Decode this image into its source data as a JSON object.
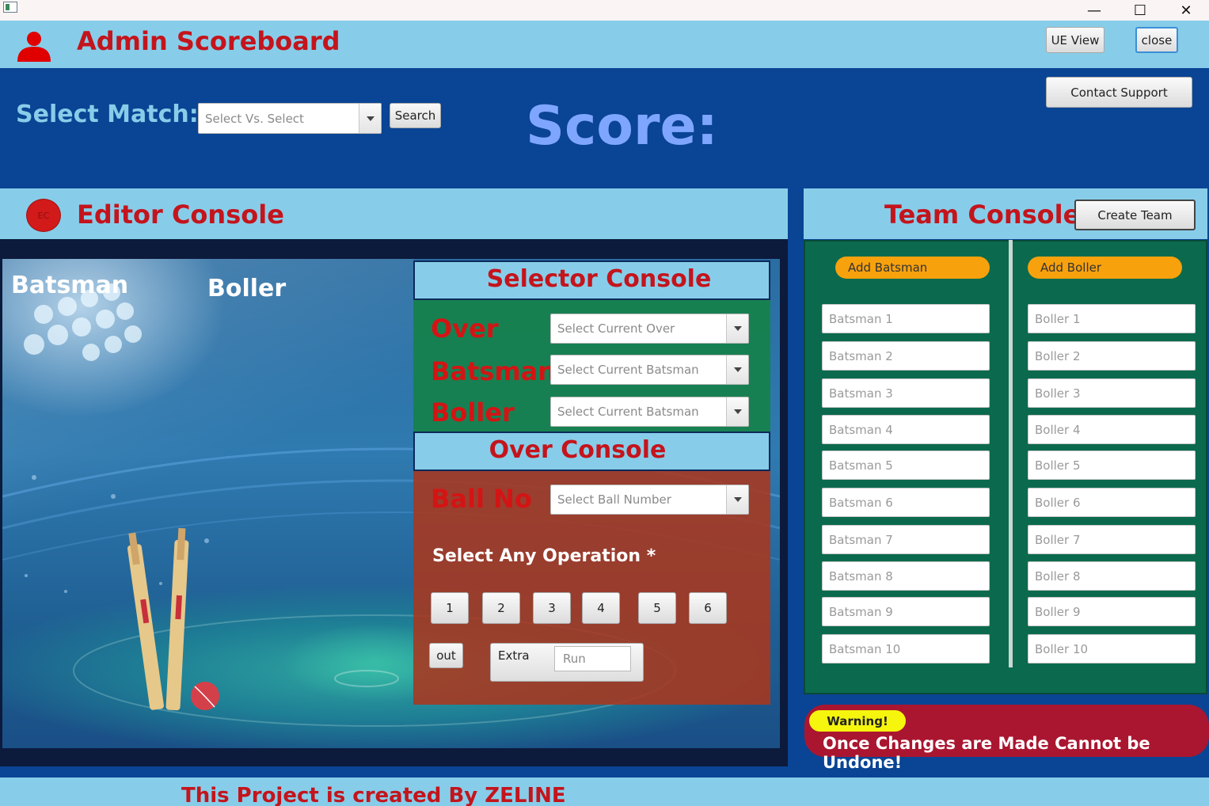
{
  "window": {
    "minimize": "—",
    "maximize": "☐",
    "close": "✕"
  },
  "header": {
    "title": "Admin Scoreboard",
    "ue_view_label": "UE View",
    "close_label": "close"
  },
  "top": {
    "match_label": "Select Match:",
    "match_placeholder": "Select Vs. Select",
    "search_label": "Search",
    "score_label": "Score:",
    "contact_label": "Contact Support"
  },
  "editor": {
    "badge": "EC",
    "title": "Editor Console",
    "batsman_label": "Batsman",
    "boller_label": "Boller"
  },
  "selector": {
    "title": "Selector Console",
    "over_label": "Over",
    "over_placeholder": "Select Current Over",
    "batsman_label": "Batsman",
    "batsman_placeholder": "Select Current Batsman",
    "boller_label": "Boller",
    "boller_placeholder": "Select Current Batsman"
  },
  "over_console": {
    "title": "Over Console",
    "ball_label": "Ball No",
    "ball_placeholder": "Select Ball Number",
    "operation_label": "Select Any Operation *",
    "run_buttons": [
      "1",
      "2",
      "3",
      "4",
      "5",
      "6"
    ],
    "out_label": "out",
    "extra_label": "Extra",
    "run_placeholder": "Run"
  },
  "team": {
    "title": "Team Console",
    "create_label": "Create Team",
    "add_batsman_label": "Add Batsman",
    "add_boller_label": "Add Boller",
    "batsmen": [
      "Batsman 1",
      "Batsman 2",
      "Batsman 3",
      "Batsman 4",
      "Batsman 5",
      "Batsman 6",
      "Batsman 7",
      "Batsman 8",
      "Batsman 9",
      "Batsman 10"
    ],
    "bollers": [
      "Boller 1",
      "Boller 2",
      "Boller 3",
      "Boller 4",
      "Boller 5",
      "Boller 6",
      "Boller 7",
      "Boller 8",
      "Boller 9",
      "Boller 10"
    ]
  },
  "warning": {
    "badge": "Warning!",
    "message": "Once Changes are Made Cannot be Undone!"
  },
  "footer": {
    "text": "This Project is created By ZELINE"
  },
  "colors": {
    "accent_red": "#c4141c",
    "header_blue": "#87cde9",
    "bg_blue": "#0a4494",
    "team_green": "#0b6a4d"
  }
}
